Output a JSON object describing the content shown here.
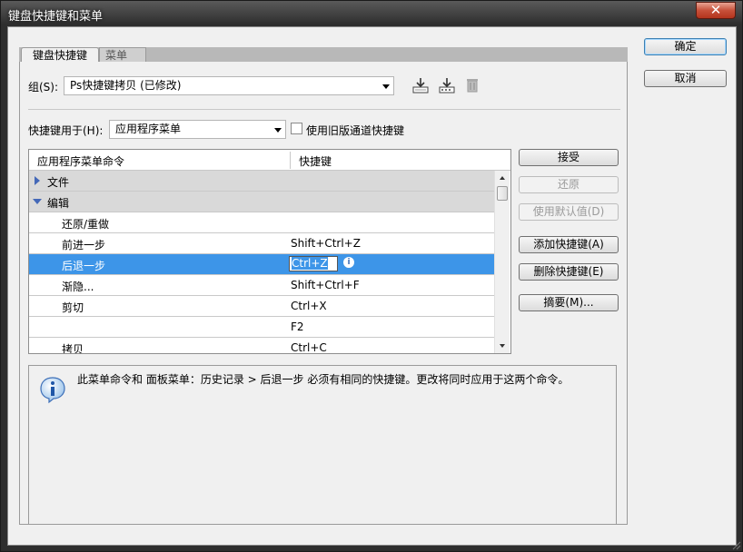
{
  "window": {
    "title": "键盘快捷键和菜单",
    "close_glyph": "✕"
  },
  "tabs": [
    {
      "label": "键盘快捷键",
      "active": true
    },
    {
      "label": "菜单",
      "active": false
    }
  ],
  "group": {
    "label": "组(S):",
    "value": "Ps快捷键拷贝 (已修改)"
  },
  "icons": {
    "save": "save-set-icon",
    "save_as": "save-as-set-icon",
    "delete": "delete-set-icon",
    "info": "info-icon"
  },
  "shortcuts_for": {
    "label": "快捷键用于(H):",
    "value": "应用程序菜单"
  },
  "legacy_checkbox": {
    "label": "使用旧版通道快捷键",
    "checked": false
  },
  "table": {
    "col_command": "应用程序菜单命令",
    "col_shortcut": "快捷键",
    "rows": [
      {
        "kind": "group",
        "expanded": false,
        "command": "文件",
        "shortcut": ""
      },
      {
        "kind": "group",
        "expanded": true,
        "command": "编辑",
        "shortcut": ""
      },
      {
        "kind": "item",
        "command": "还原/重做",
        "shortcut": ""
      },
      {
        "kind": "item",
        "command": "前进一步",
        "shortcut": "Shift+Ctrl+Z"
      },
      {
        "kind": "item",
        "command": "后退一步",
        "shortcut": "Ctrl+Z",
        "selected": true
      },
      {
        "kind": "item",
        "command": "渐隐...",
        "shortcut": "Shift+Ctrl+F"
      },
      {
        "kind": "item",
        "command": "剪切",
        "shortcut": "Ctrl+X"
      },
      {
        "kind": "item",
        "command": "",
        "shortcut": "F2"
      },
      {
        "kind": "item",
        "command": "拷贝",
        "shortcut": "Ctrl+C"
      }
    ]
  },
  "side_buttons": {
    "accept": "接受",
    "undo": "还原",
    "use_default": "使用默认值(D)",
    "add_shortcut": "添加快捷键(A)",
    "delete_shortcut": "删除快捷键(E)",
    "summarize": "摘要(M)..."
  },
  "dialog_buttons": {
    "ok": "确定",
    "cancel": "取消"
  },
  "message": "此菜单命令和 面板菜单：历史记录 > 后退一步 必须有相同的快捷键。更改将同时应用于这两个命令。",
  "colors": {
    "selection": "#3d95e8",
    "group_row": "#d9d9d9",
    "expander": "#4468b8"
  }
}
